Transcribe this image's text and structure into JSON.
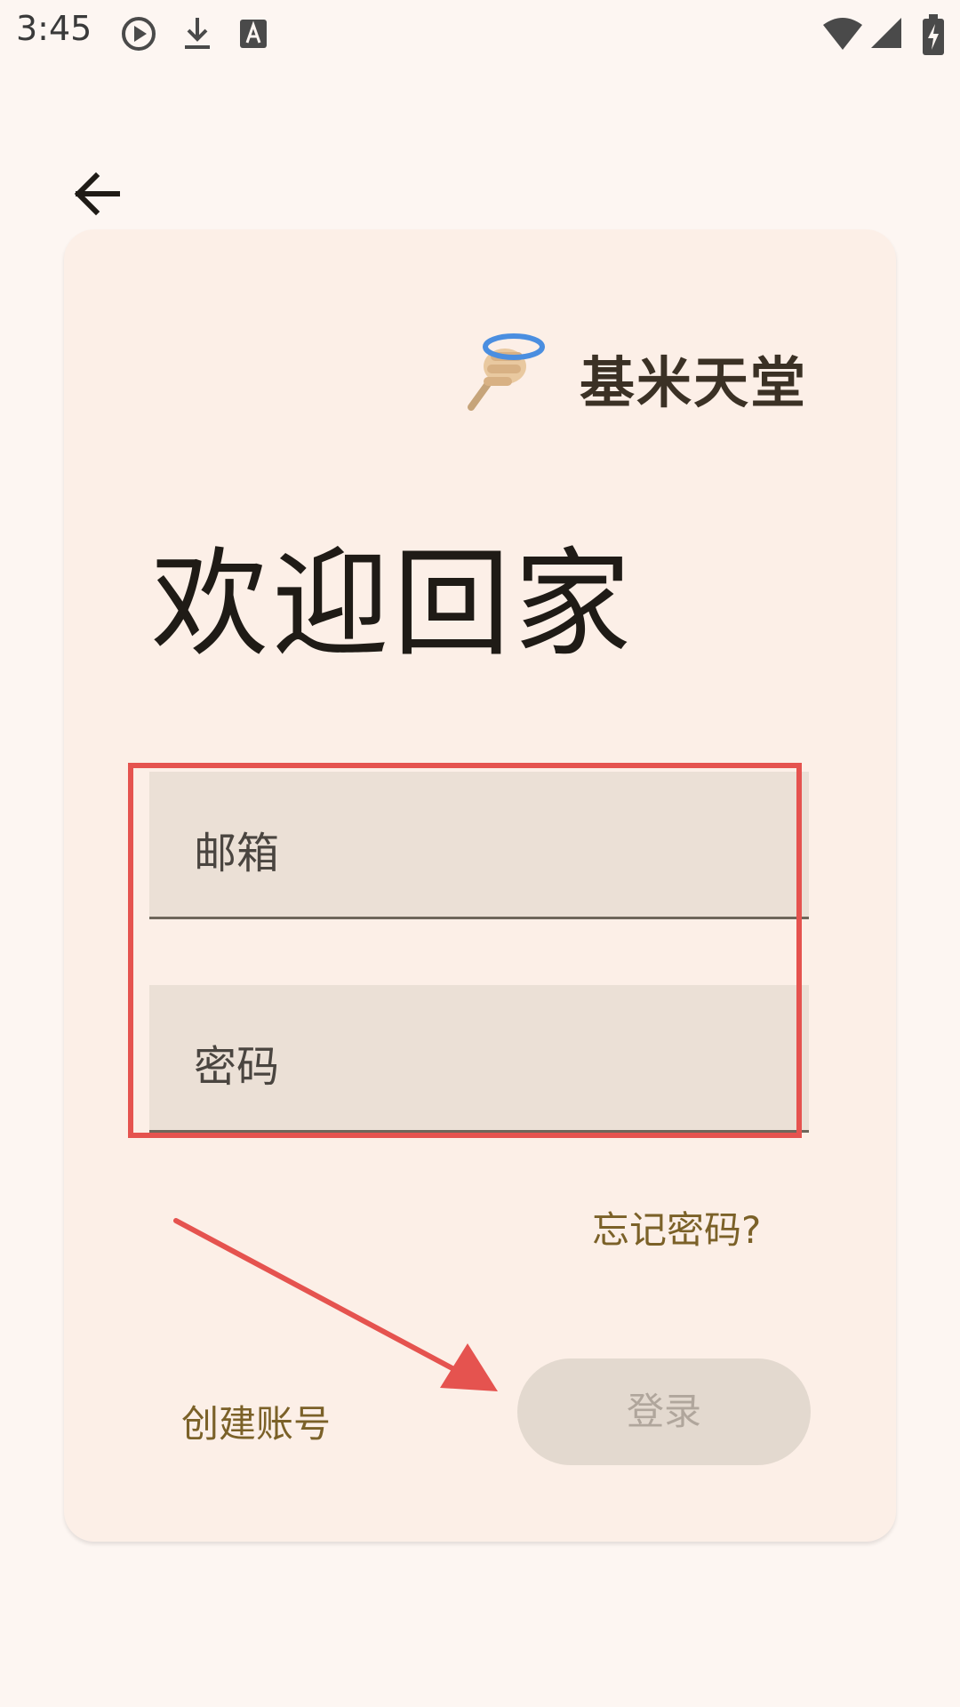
{
  "status_bar": {
    "time": "3:45"
  },
  "app": {
    "name": "基米天堂"
  },
  "login": {
    "welcome_title": "欢迎回家",
    "email_placeholder": "邮箱",
    "password_placeholder": "密码",
    "forgot_password": "忘记密码?",
    "create_account": "创建账号",
    "login_button": "登录"
  },
  "colors": {
    "background": "#fdf6f2",
    "card": "#fcefe7",
    "field": "#ebe0d6",
    "accent_text": "#7b6128",
    "highlight": "#e5534f"
  }
}
